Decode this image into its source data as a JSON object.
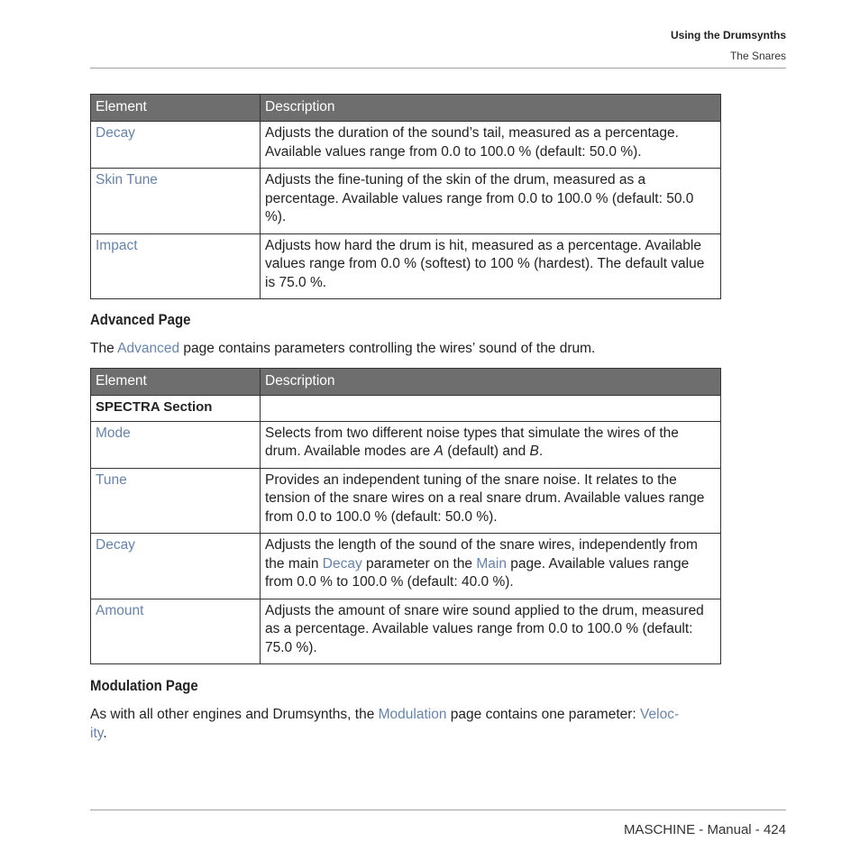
{
  "header": {
    "chapter": "Using the Drumsynths",
    "section": "The Snares"
  },
  "table1": {
    "columns": [
      "Element",
      "Description"
    ],
    "rows": [
      {
        "element": "Decay",
        "description": "Adjusts the duration of the sound’s tail, measured as a percentage. Available values range from 0.0 to 100.0 % (default: 50.0 %)."
      },
      {
        "element": "Skin Tune",
        "description": "Adjusts the fine-tuning of the skin of the drum, measured as a percentage. Available values range from 0.0 to 100.0 % (default: 50.0 %)."
      },
      {
        "element": "Impact",
        "description": "Adjusts how hard the drum is hit, measured as a percentage. Available values range from 0.0 % (softest) to 100 % (hardest). The default value is 75.0 %."
      }
    ]
  },
  "advanced": {
    "heading": "Advanced Page",
    "intro_pre": "The ",
    "intro_link": "Advanced",
    "intro_post": " page contains parameters controlling the wires’ sound of the drum."
  },
  "table2": {
    "columns": [
      "Element",
      "Description"
    ],
    "section_label": "SPECTRA Section",
    "rows": [
      {
        "element": "Mode",
        "desc_pre": "Selects from two different noise types that simulate the wires of the drum. Available modes are ",
        "desc_a": "A",
        "desc_mid": " (default) and ",
        "desc_b": "B",
        "desc_post": "."
      },
      {
        "element": "Tune",
        "description": "Provides an independent tuning of the snare noise. It relates to the tension of the snare wires on a real snare drum. Available values range from 0.0 to 100.0 % (default: 50.0 %)."
      },
      {
        "element": "Decay",
        "desc_pre": "Adjusts the length of the sound of the snare wires, independently from the main ",
        "desc_link1": "Decay",
        "desc_mid": " parameter on the ",
        "desc_link2": "Main",
        "desc_post": " page. Available values range from 0.0 % to 100.0 % (default: 40.0 %)."
      },
      {
        "element": "Amount",
        "description": "Adjusts the amount of snare wire sound applied to the drum, measured as a percentage. Available values range from 0.0 to 100.0 % (default: 75.0 %)."
      }
    ]
  },
  "modulation": {
    "heading": "Modulation Page",
    "text_pre": "As with all other engines and Drumsynths, the ",
    "text_link1": "Modulation",
    "text_mid": " page contains one parameter: ",
    "text_link2": "Veloc-ity",
    "text_post": "."
  },
  "footer": {
    "text": "MASCHINE - Manual - 424"
  },
  "colors": {
    "link": "#6484ad",
    "table_header_bg": "#6f6e6e"
  }
}
